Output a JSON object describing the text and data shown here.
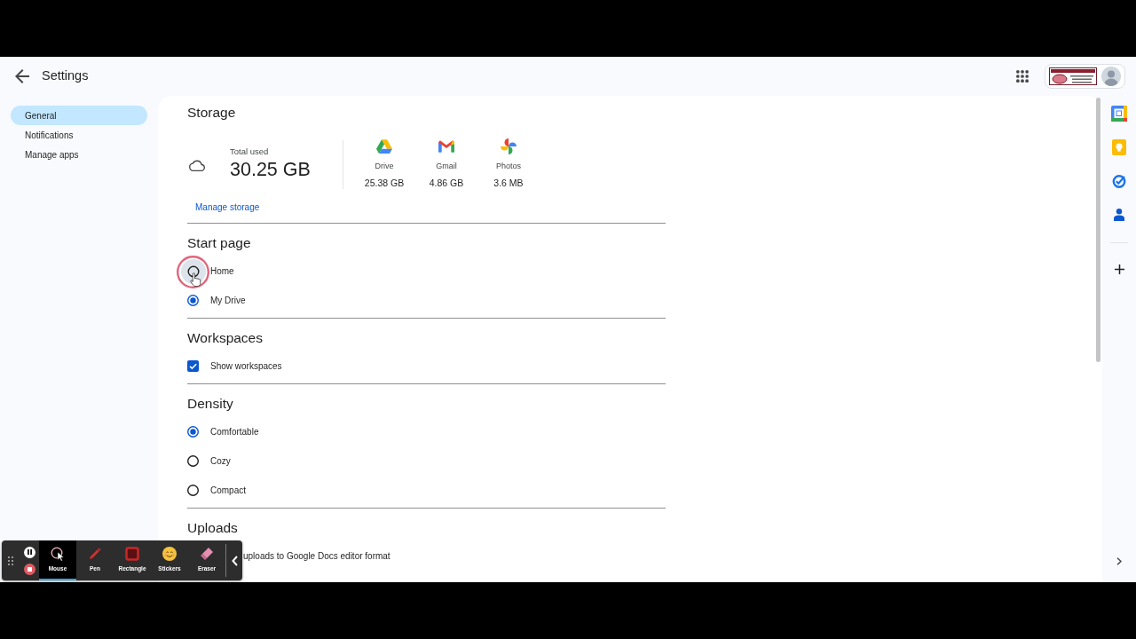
{
  "window": {
    "title": "Settings"
  },
  "sidebar": {
    "items": [
      {
        "label": "General",
        "selected": true
      },
      {
        "label": "Notifications",
        "selected": false
      },
      {
        "label": "Manage apps",
        "selected": false
      }
    ]
  },
  "storage": {
    "title": "Storage",
    "total_label": "Total used",
    "total": "30.25 GB",
    "apps": [
      {
        "kind": "drive",
        "name": "Drive",
        "used": "25.38 GB"
      },
      {
        "kind": "gmail",
        "name": "Gmail",
        "used": "4.86 GB"
      },
      {
        "kind": "photos",
        "name": "Photos",
        "used": "3.6 MB"
      }
    ],
    "link": "Manage storage"
  },
  "sections": [
    {
      "title": "Start page",
      "options": [
        {
          "kind": "radio",
          "label": "Home",
          "selected": false,
          "hovered": true
        },
        {
          "kind": "radio",
          "label": "My Drive",
          "selected": true,
          "hovered": false
        }
      ]
    },
    {
      "title": "Workspaces",
      "options": [
        {
          "kind": "checkbox",
          "label": "Show workspaces",
          "checked": true,
          "hovered": false
        }
      ]
    },
    {
      "title": "Density",
      "options": [
        {
          "kind": "radio",
          "label": "Comfortable",
          "selected": true,
          "hovered": false
        },
        {
          "kind": "radio",
          "label": "Cozy",
          "selected": false,
          "hovered": false
        },
        {
          "kind": "radio",
          "label": "Compact",
          "selected": false,
          "hovered": false
        }
      ]
    },
    {
      "title": "Uploads",
      "options": [
        {
          "kind": "covered",
          "label": "uploads to Google Docs editor format"
        }
      ]
    }
  ],
  "recorder": {
    "tools": [
      {
        "kind": "mouse",
        "label": "Mouse",
        "selected": true
      },
      {
        "kind": "pen",
        "label": "Pen",
        "selected": false
      },
      {
        "kind": "rectangle",
        "label": "Rectangle",
        "selected": false
      },
      {
        "kind": "stickers",
        "label": "Stickers",
        "selected": false
      },
      {
        "kind": "eraser",
        "label": "Eraser",
        "selected": false
      }
    ]
  }
}
